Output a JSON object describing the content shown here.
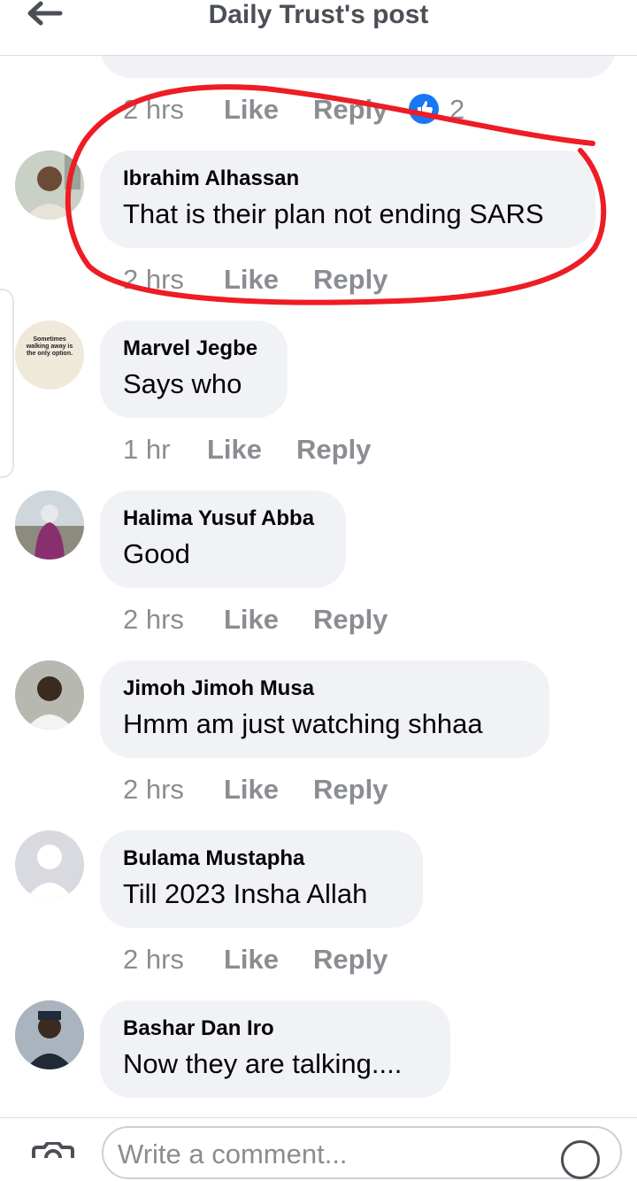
{
  "header": {
    "title": "Daily Trust's post"
  },
  "top_meta": {
    "time": "2 hrs",
    "like": "Like",
    "reply": "Reply",
    "reaction_count": "2"
  },
  "comments": [
    {
      "name": "Ibrahim Alhassan",
      "text": "That is their plan not ending SARS",
      "time": "2 hrs",
      "like": "Like",
      "reply": "Reply"
    },
    {
      "name": "Marvel Jegbe",
      "text": "Says who",
      "time": "1 hr",
      "like": "Like",
      "reply": "Reply",
      "avatar_text": "Sometimes walking away is the only option."
    },
    {
      "name": "Halima Yusuf Abba",
      "text": "Good",
      "time": "2 hrs",
      "like": "Like",
      "reply": "Reply"
    },
    {
      "name": "Jimoh Jimoh Musa",
      "text": "Hmm am just watching shhaa",
      "time": "2 hrs",
      "like": "Like",
      "reply": "Reply"
    },
    {
      "name": "Bulama Mustapha",
      "text": "Till 2023 Insha Allah",
      "time": "2 hrs",
      "like": "Like",
      "reply": "Reply"
    },
    {
      "name": "Bashar Dan Iro",
      "text": "Now they are talking....",
      "time": "",
      "like": "",
      "reply": ""
    }
  ],
  "composer": {
    "placeholder": "Write a comment..."
  },
  "annotation": {
    "color": "#ee1c24"
  },
  "colors": {
    "bubble": "#f0f2f5",
    "meta": "#8a8d91",
    "accent": "#1877f2"
  }
}
